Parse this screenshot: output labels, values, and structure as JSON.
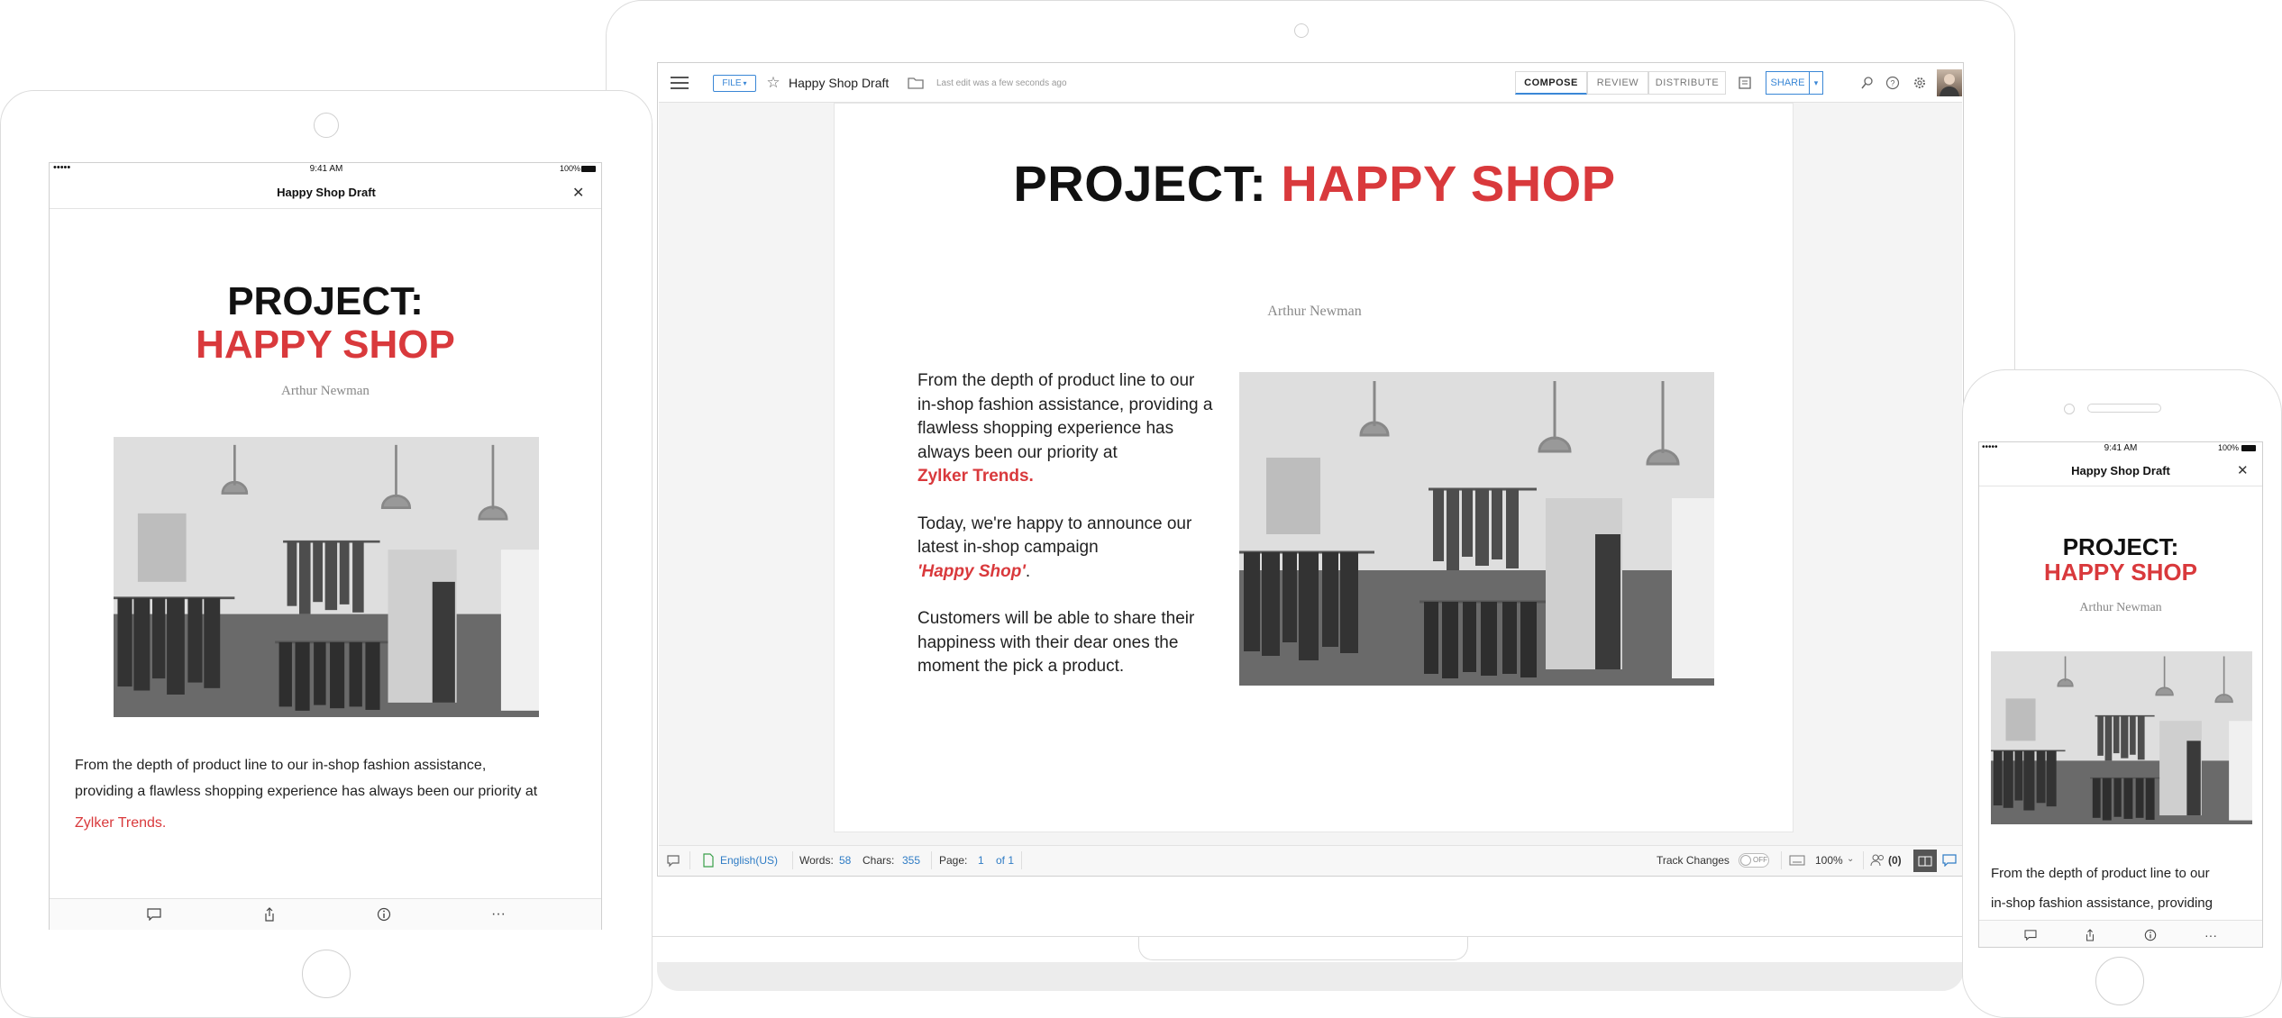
{
  "document": {
    "title_prefix": "PROJECT:",
    "title_highlight": "HAPPY SHOP",
    "title_desktop_prefix": "PROJECT: ",
    "author": "Arthur Newman",
    "para1": "From the depth of product line to our in-shop fashion assistance, providing a flawless shopping experience has always been our priority at",
    "para1_highlight": "Zylker Trends.",
    "para2": "Today, we're happy to announce our latest in-shop campaign",
    "para2_highlight": "'Happy Shop'",
    "para2_end": ".",
    "para3": "Customers will be able to share their happiness with their dear ones the moment the pick a product."
  },
  "editor": {
    "file_label": "FILE",
    "doc_name": "Happy Shop Draft",
    "last_edit": "Last edit was a few seconds ago",
    "tabs": [
      "COMPOSE",
      "REVIEW",
      "DISTRIBUTE"
    ],
    "share_label": "SHARE"
  },
  "statusbar": {
    "language": "English(US)",
    "words_label": "Words:",
    "words_value": "58",
    "chars_label": "Chars:",
    "chars_value": "355",
    "page_label": "Page:",
    "page_value": "1",
    "page_of": "of 1",
    "track_changes_label": "Track Changes",
    "track_toggle": "OFF",
    "zoom": "100%",
    "collaborators": "(0)"
  },
  "mobile": {
    "time": "9:41 AM",
    "battery": "100%",
    "signal": "•••••",
    "header_title": "Happy Shop Draft",
    "tablet_para_line1": "From the depth of product line to our in-shop fashion assistance,",
    "tablet_para_line2": "providing a flawless shopping experience has always been our priority at",
    "phone_para_line1": "From the depth of product line to our",
    "phone_para_line2": "in-shop fashion assistance, providing"
  },
  "colors": {
    "accent_red": "#d9393c",
    "link_blue": "#2f7cc5"
  }
}
